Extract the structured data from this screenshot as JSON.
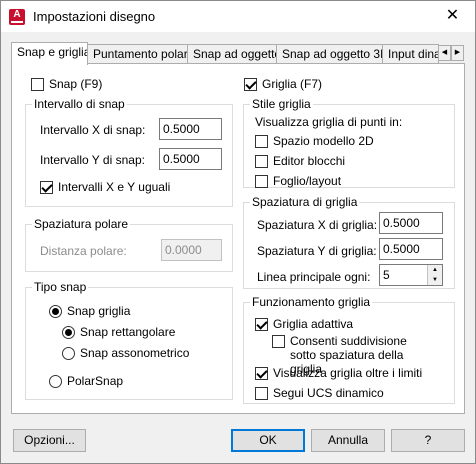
{
  "window": {
    "title": "Impostazioni disegno",
    "app_icon_letter": "A",
    "close_glyph": "✕"
  },
  "tabs": [
    {
      "label": "Snap e griglia",
      "active": true
    },
    {
      "label": "Puntamento polare",
      "active": false
    },
    {
      "label": "Snap ad oggetto",
      "active": false
    },
    {
      "label": "Snap ad oggetto 3D",
      "active": false
    },
    {
      "label": "Input dina",
      "active": false
    }
  ],
  "tab_scroll": {
    "left_glyph": "◀",
    "right_glyph": "▶"
  },
  "snap": {
    "toggle_label": "Snap (F9)",
    "toggle_checked": false,
    "interval_group_title": "Intervallo di snap",
    "x_label": "Intervallo X di snap:",
    "x_value": "0.5000",
    "y_label": "Intervallo Y di snap:",
    "y_value": "0.5000",
    "equal_label": "Intervalli X e Y uguali",
    "equal_checked": true
  },
  "polar": {
    "group_title": "Spaziatura polare",
    "distance_label": "Distanza polare:",
    "distance_value": "0.0000"
  },
  "snap_type": {
    "group_title": "Tipo snap",
    "grid_snap_label": "Snap griglia",
    "rect_label": "Snap rettangolare",
    "iso_label": "Snap assonometrico",
    "polar_label": "PolarSnap"
  },
  "grid": {
    "toggle_label": "Griglia (F7)",
    "toggle_checked": true,
    "style_group_title": "Stile griglia",
    "style_caption": "Visualizza griglia di punti in:",
    "model_label": "Spazio modello 2D",
    "block_label": "Editor blocchi",
    "layout_label": "Foglio/layout",
    "spacing_group_title": "Spaziatura di griglia",
    "x_label": "Spaziatura X di griglia:",
    "x_value": "0.5000",
    "y_label": "Spaziatura Y di griglia:",
    "y_value": "0.5000",
    "major_label": "Linea principale ogni:",
    "major_value": "5",
    "behavior_group_title": "Funzionamento griglia",
    "adaptive_label": "Griglia adattiva",
    "subdivision_label": "Consenti suddivisione sotto spaziatura della griglia",
    "beyond_limits_label": "Visualizza griglia oltre i limiti",
    "follow_ucs_label": "Segui UCS dinamico"
  },
  "buttons": {
    "options": "Opzioni...",
    "ok": "OK",
    "cancel": "Annulla",
    "help": "?"
  }
}
